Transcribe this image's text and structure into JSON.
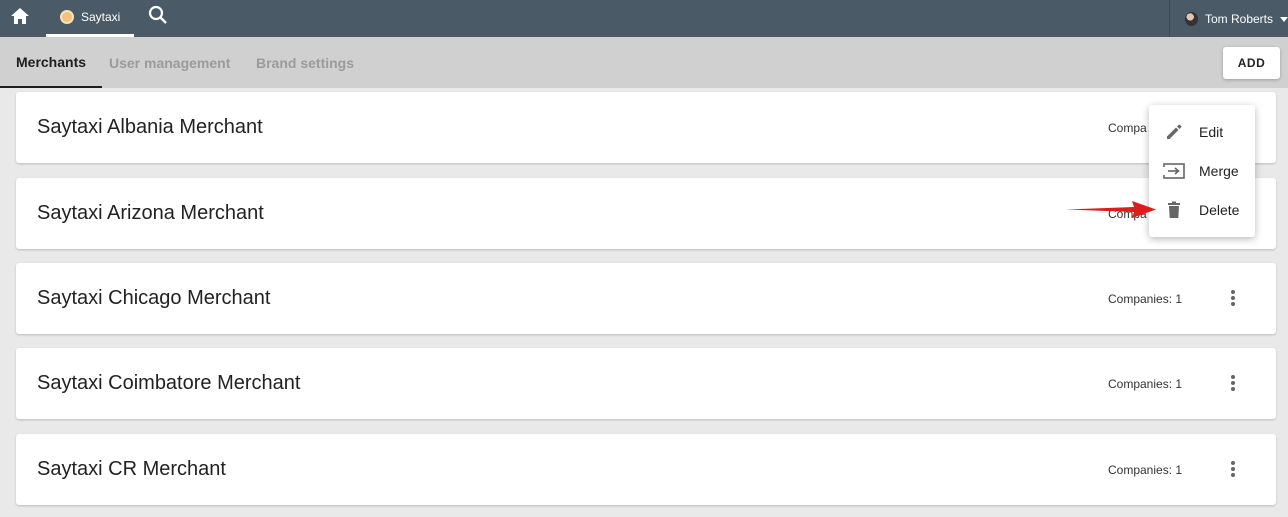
{
  "topbar": {
    "brand_label": "Saytaxi",
    "user_name": "Tom Roberts"
  },
  "tabs": [
    "Merchants",
    "User management",
    "Brand settings"
  ],
  "add_label": "ADD",
  "merchants": [
    {
      "name": "Saytaxi Albania Merchant",
      "companies": "Compa"
    },
    {
      "name": "Saytaxi Arizona Merchant",
      "companies": "Compa"
    },
    {
      "name": "Saytaxi Chicago Merchant",
      "companies": "Companies: 1"
    },
    {
      "name": "Saytaxi Coimbatore Merchant",
      "companies": "Companies: 1"
    },
    {
      "name": "Saytaxi CR Merchant",
      "companies": "Companies: 1"
    }
  ],
  "menu": {
    "items": [
      {
        "label": "Edit",
        "icon": "pencil-icon"
      },
      {
        "label": "Merge",
        "icon": "merge-icon"
      },
      {
        "label": "Delete",
        "icon": "trash-icon"
      }
    ]
  },
  "colors": {
    "topbar": "#4a5a66",
    "subnav": "#d0d0d0",
    "arrow": "#e01b1b"
  }
}
